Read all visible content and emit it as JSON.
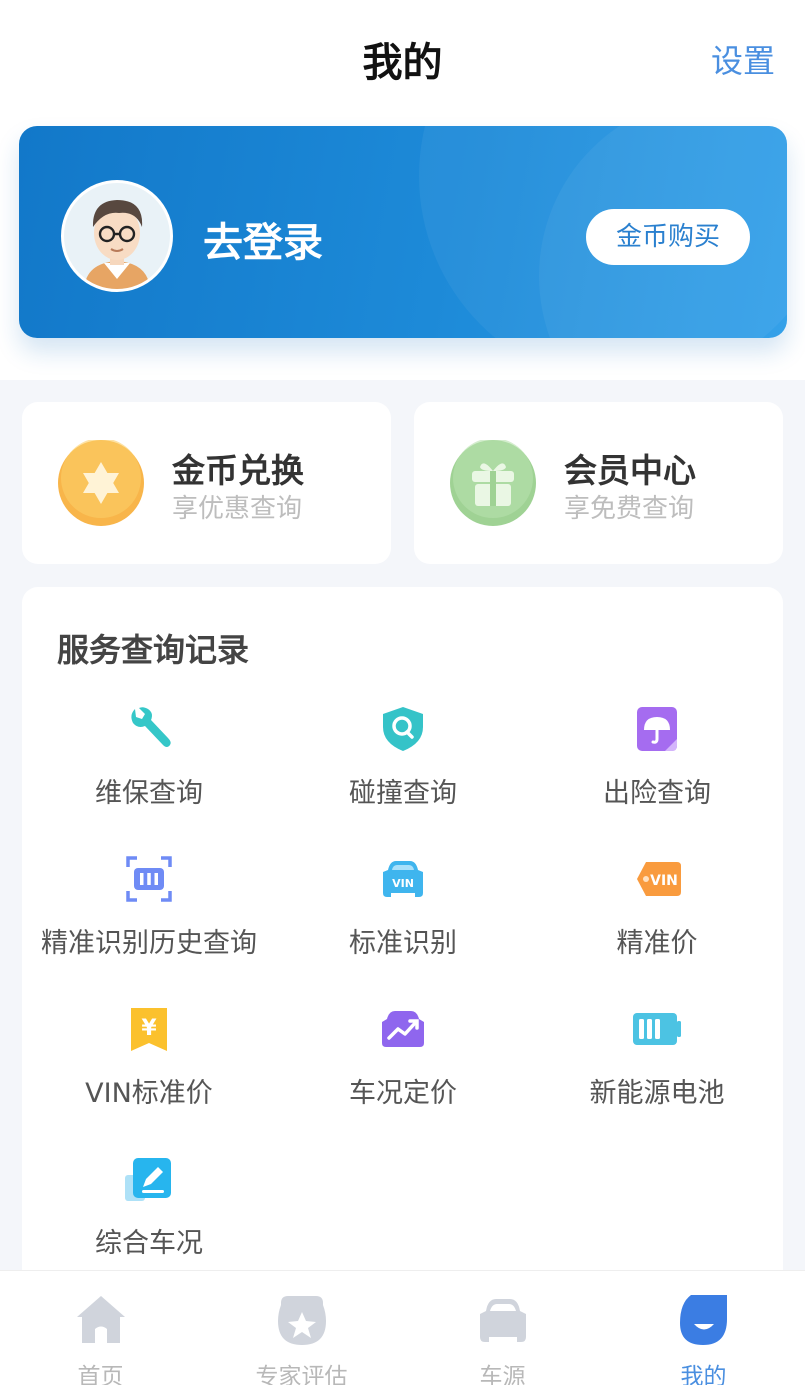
{
  "header": {
    "title": "我的",
    "settings_label": "设置"
  },
  "profile": {
    "login_label": "去登录",
    "coin_buy_label": "金币购买"
  },
  "quick_cards": [
    {
      "title": "金币兑换",
      "subtitle": "享优惠查询",
      "icon": "star-coin-icon"
    },
    {
      "title": "会员中心",
      "subtitle": "享免费查询",
      "icon": "gift-icon"
    }
  ],
  "services": {
    "title": "服务查询记录",
    "items": [
      {
        "label": "维保查询",
        "icon": "wrench-icon"
      },
      {
        "label": "碰撞查询",
        "icon": "shield-search-icon"
      },
      {
        "label": "出险查询",
        "icon": "umbrella-doc-icon"
      },
      {
        "label": "精准识别历史查询",
        "icon": "scan-frame-icon"
      },
      {
        "label": "标准识别",
        "icon": "car-vin-icon",
        "icon_text": "VIN"
      },
      {
        "label": "精准价",
        "icon": "vin-tag-icon",
        "icon_text": "VIN"
      },
      {
        "label": "VIN标准价",
        "icon": "yen-bookmark-icon",
        "icon_text": "¥"
      },
      {
        "label": "车况定价",
        "icon": "trend-car-icon"
      },
      {
        "label": "新能源电池",
        "icon": "battery-icon"
      },
      {
        "label": "综合车况",
        "icon": "edit-note-icon"
      }
    ]
  },
  "tabbar": [
    {
      "label": "首页",
      "icon": "home-icon",
      "active": false
    },
    {
      "label": "专家评估",
      "icon": "expert-badge-icon",
      "active": false
    },
    {
      "label": "车源",
      "icon": "car-icon",
      "active": false
    },
    {
      "label": "我的",
      "icon": "profile-face-icon",
      "active": true
    }
  ],
  "colors": {
    "accent": "#4a8fe0",
    "card_gradient_start": "#1278c9",
    "card_gradient_end": "#2a9ce8"
  }
}
